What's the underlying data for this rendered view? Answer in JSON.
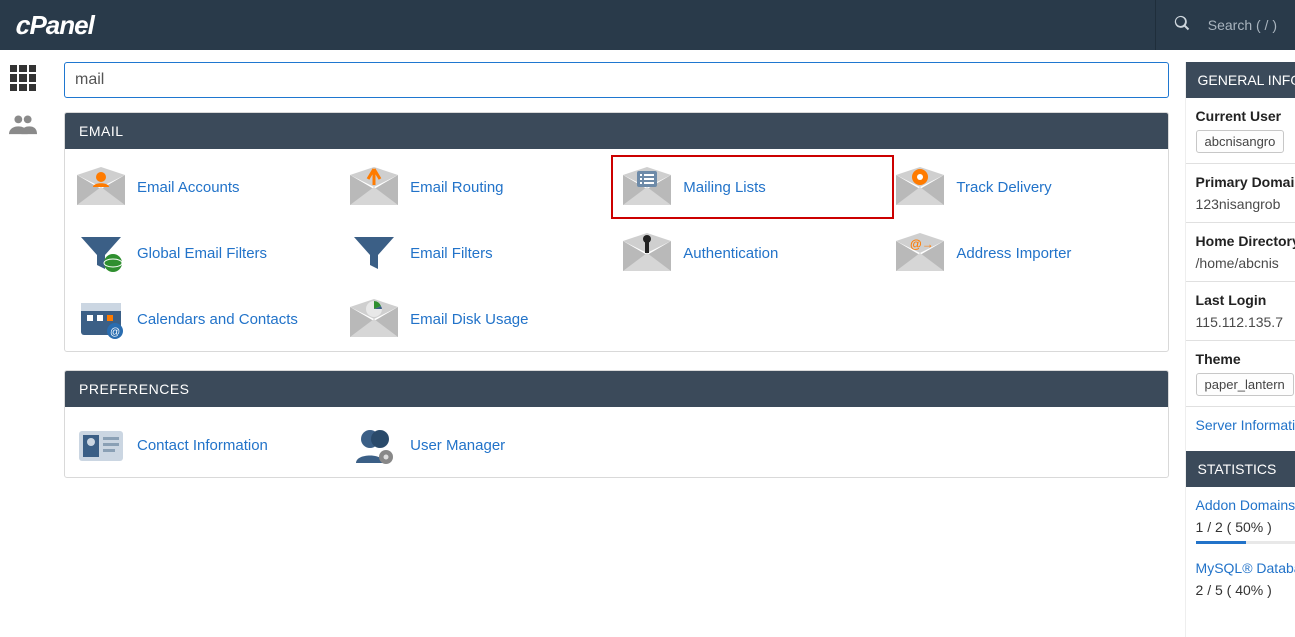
{
  "top": {
    "logo": "cPanel",
    "search_placeholder": "Search ( / )"
  },
  "search": {
    "value": "mail"
  },
  "sections": [
    {
      "id": "email",
      "title": "EMAIL",
      "items": [
        {
          "id": "email-accounts",
          "label": "Email Accounts",
          "icon": "person"
        },
        {
          "id": "email-routing",
          "label": "Email Routing",
          "icon": "routing"
        },
        {
          "id": "mailing-lists",
          "label": "Mailing Lists",
          "icon": "list",
          "highlight": true
        },
        {
          "id": "track-delivery",
          "label": "Track Delivery",
          "icon": "track"
        },
        {
          "id": "global-filters",
          "label": "Global Email Filters",
          "icon": "globalfilter"
        },
        {
          "id": "email-filters",
          "label": "Email Filters",
          "icon": "filter"
        },
        {
          "id": "authentication",
          "label": "Authentication",
          "icon": "key"
        },
        {
          "id": "address-importer",
          "label": "Address Importer",
          "icon": "importer"
        },
        {
          "id": "cal-contacts",
          "label": "Calendars and Contacts",
          "icon": "calendar"
        },
        {
          "id": "email-disk",
          "label": "Email Disk Usage",
          "icon": "disk"
        }
      ]
    },
    {
      "id": "preferences",
      "title": "PREFERENCES",
      "items": [
        {
          "id": "contact-info",
          "label": "Contact Information",
          "icon": "contact"
        },
        {
          "id": "user-manager",
          "label": "User Manager",
          "icon": "usermgr"
        }
      ]
    }
  ],
  "general": {
    "header": "GENERAL INFORMATION",
    "current_user_label": "Current User",
    "current_user_value": "abcnisangro",
    "primary_domain_label": "Primary Domain",
    "primary_domain_value": "123nisangrob",
    "home_dir_label": "Home Directory",
    "home_dir_value": "/home/abcnis",
    "last_login_label": "Last Login",
    "last_login_value": "115.112.135.7",
    "theme_label": "Theme",
    "theme_value": "paper_lantern",
    "server_info": "Server Information"
  },
  "stats": {
    "header": "STATISTICS",
    "addon_label": "Addon Domains",
    "addon_value": "1 / 2 ( 50% )",
    "addon_pct": 50,
    "mysql_label": "MySQL® Databases",
    "mysql_value": "2 / 5 ( 40% )",
    "mysql_pct": 40
  }
}
